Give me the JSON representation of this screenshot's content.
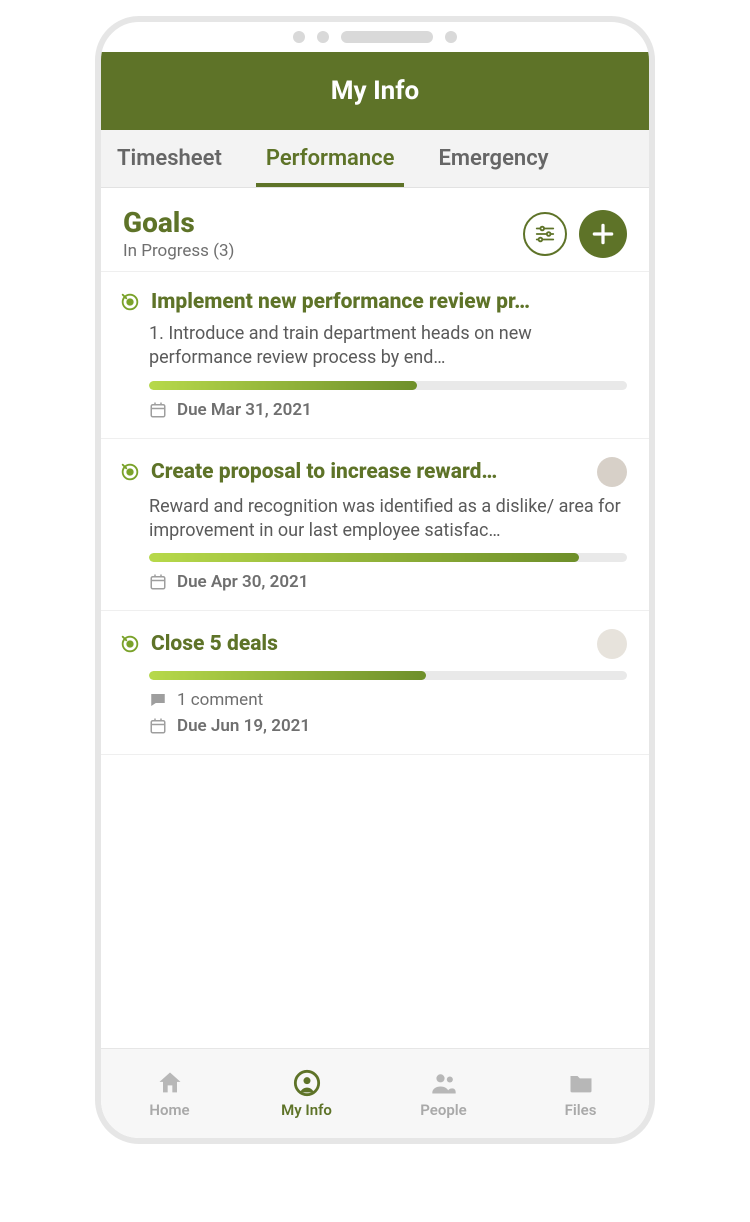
{
  "header": {
    "title": "My Info"
  },
  "tabs": [
    {
      "label": "Timesheet",
      "active": false
    },
    {
      "label": "Performance",
      "active": true
    },
    {
      "label": "Emergency",
      "active": false
    }
  ],
  "section": {
    "title": "Goals",
    "subtitle": "In Progress (3)"
  },
  "goals": [
    {
      "title": "Implement new performance review pr…",
      "desc": "1. Introduce and train department heads on new performance review process by end…",
      "progress": 56,
      "due": "Due Mar 31, 2021",
      "comments": null,
      "hasAvatar": false
    },
    {
      "title": "Create proposal to increase reward…",
      "desc": "Reward and recognition was identified as a dislike/ area for improvement in our last employee satisfac…",
      "progress": 90,
      "due": "Due Apr 30, 2021",
      "comments": null,
      "hasAvatar": true
    },
    {
      "title": "Close 5 deals",
      "desc": "",
      "progress": 58,
      "due": "Due Jun 19, 2021",
      "comments": "1 comment",
      "hasAvatar": true
    }
  ],
  "nav": [
    {
      "label": "Home",
      "icon": "home-icon",
      "active": false
    },
    {
      "label": "My Info",
      "icon": "profile-icon",
      "active": true
    },
    {
      "label": "People",
      "icon": "people-icon",
      "active": false
    },
    {
      "label": "Files",
      "icon": "folder-icon",
      "active": false
    }
  ]
}
